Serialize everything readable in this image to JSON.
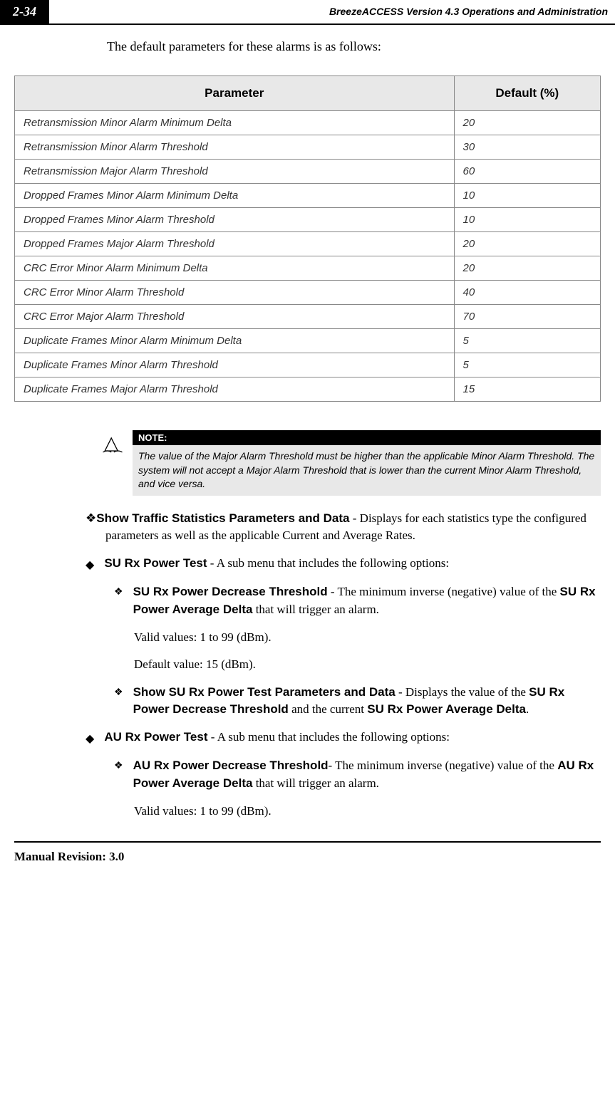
{
  "header": {
    "page_number": "2-34",
    "title": "BreezeACCESS Version 4.3 Operations and Administration"
  },
  "intro": "The default parameters for these alarms is as follows:",
  "table": {
    "headers": [
      "Parameter",
      "Default (%)"
    ],
    "rows": [
      [
        "Retransmission Minor Alarm Minimum Delta",
        "20"
      ],
      [
        "Retransmission Minor Alarm Threshold",
        "30"
      ],
      [
        "Retransmission Major Alarm Threshold",
        "60"
      ],
      [
        "Dropped Frames Minor Alarm Minimum Delta",
        "10"
      ],
      [
        "Dropped Frames Minor Alarm Threshold",
        "10"
      ],
      [
        "Dropped Frames Major Alarm Threshold",
        "20"
      ],
      [
        "CRC Error Minor Alarm Minimum Delta",
        "20"
      ],
      [
        "CRC Error Minor Alarm Threshold",
        "40"
      ],
      [
        "CRC Error Major Alarm Threshold",
        "70"
      ],
      [
        "Duplicate Frames Minor Alarm Minimum Delta",
        "5"
      ],
      [
        "Duplicate Frames Minor Alarm Threshold",
        "5"
      ],
      [
        "Duplicate Frames Major Alarm Threshold",
        "15"
      ]
    ]
  },
  "note": {
    "label": "NOTE:",
    "text": "The value of the Major Alarm Threshold must be higher than the applicable Minor Alarm Threshold. The system will not accept a Major Alarm Threshold that is lower than the current Minor Alarm Threshold, and vice versa."
  },
  "body": {
    "show_traffic_bold": "Show Traffic Statistics Parameters and Data",
    "show_traffic_rest": " - Displays for each statistics type the configured parameters as well as the applicable Current and Average Rates.",
    "su_rx_bold": "SU Rx Power Test",
    "su_rx_rest": " - A sub menu that includes the following options:",
    "su_rx_dec_bold": "SU Rx Power Decrease Threshold",
    "su_rx_dec_rest_1": " - The minimum inverse (negative) value of the ",
    "su_rx_dec_bold2": "SU Rx Power Average Delta",
    "su_rx_dec_rest_2": " that will trigger an alarm.",
    "valid_values": "Valid values: 1 to 99 (dBm).",
    "default_value": "Default value: 15 (dBm).",
    "show_su_bold": "Show SU Rx Power Test Parameters and Data",
    "show_su_rest_1": " - Displays the value of the ",
    "show_su_bold2": "SU Rx Power Decrease Threshold",
    "show_su_rest_2": " and the current ",
    "show_su_bold3": "SU Rx Power Average Delta",
    "show_su_rest_3": ".",
    "au_rx_bold": "AU Rx Power Test",
    "au_rx_rest": " - A sub menu that includes the following options:",
    "au_rx_dec_bold": "AU Rx Power Decrease Threshold",
    "au_rx_dec_rest_1": "- The minimum inverse (negative) value of the ",
    "au_rx_dec_bold2": "AU Rx Power Average Delta",
    "au_rx_dec_rest_2": " that will trigger an alarm.",
    "valid_values2": "Valid values: 1 to 99 (dBm)."
  },
  "footer": "Manual Revision: 3.0"
}
